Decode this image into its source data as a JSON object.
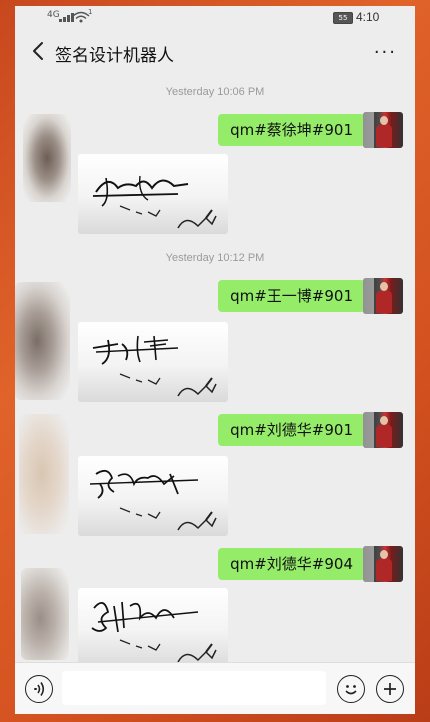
{
  "status_bar": {
    "signal_label": "4G",
    "wifi_mark": "1",
    "battery": "55",
    "time": "4:10"
  },
  "header": {
    "title": "签名设计机器人",
    "back_icon": "chevron-left-icon",
    "more_icon": "more-dots-icon",
    "more_glyph": "···"
  },
  "chat": {
    "timestamps": [
      "Yesterday 10:06 PM",
      "Yesterday 10:12 PM"
    ],
    "messages": [
      {
        "from": "user",
        "text": "qm#蔡徐坤#901"
      },
      {
        "from": "bot",
        "type": "signature-image"
      },
      {
        "from": "user",
        "text": "qm#王一博#901"
      },
      {
        "from": "bot",
        "type": "signature-image"
      },
      {
        "from": "user",
        "text": "qm#刘德华#901"
      },
      {
        "from": "bot",
        "type": "signature-image"
      },
      {
        "from": "user",
        "text": "qm#刘德华#904"
      },
      {
        "from": "bot",
        "type": "signature-image"
      }
    ]
  },
  "input_bar": {
    "voice_icon": "voice-icon",
    "emoji_icon": "emoji-icon",
    "plus_icon": "plus-icon",
    "input_value": "",
    "input_placeholder": ""
  },
  "colors": {
    "bubble_green": "#95ec69",
    "chat_bg": "#ededed",
    "frame_orange": "#d2501f"
  }
}
